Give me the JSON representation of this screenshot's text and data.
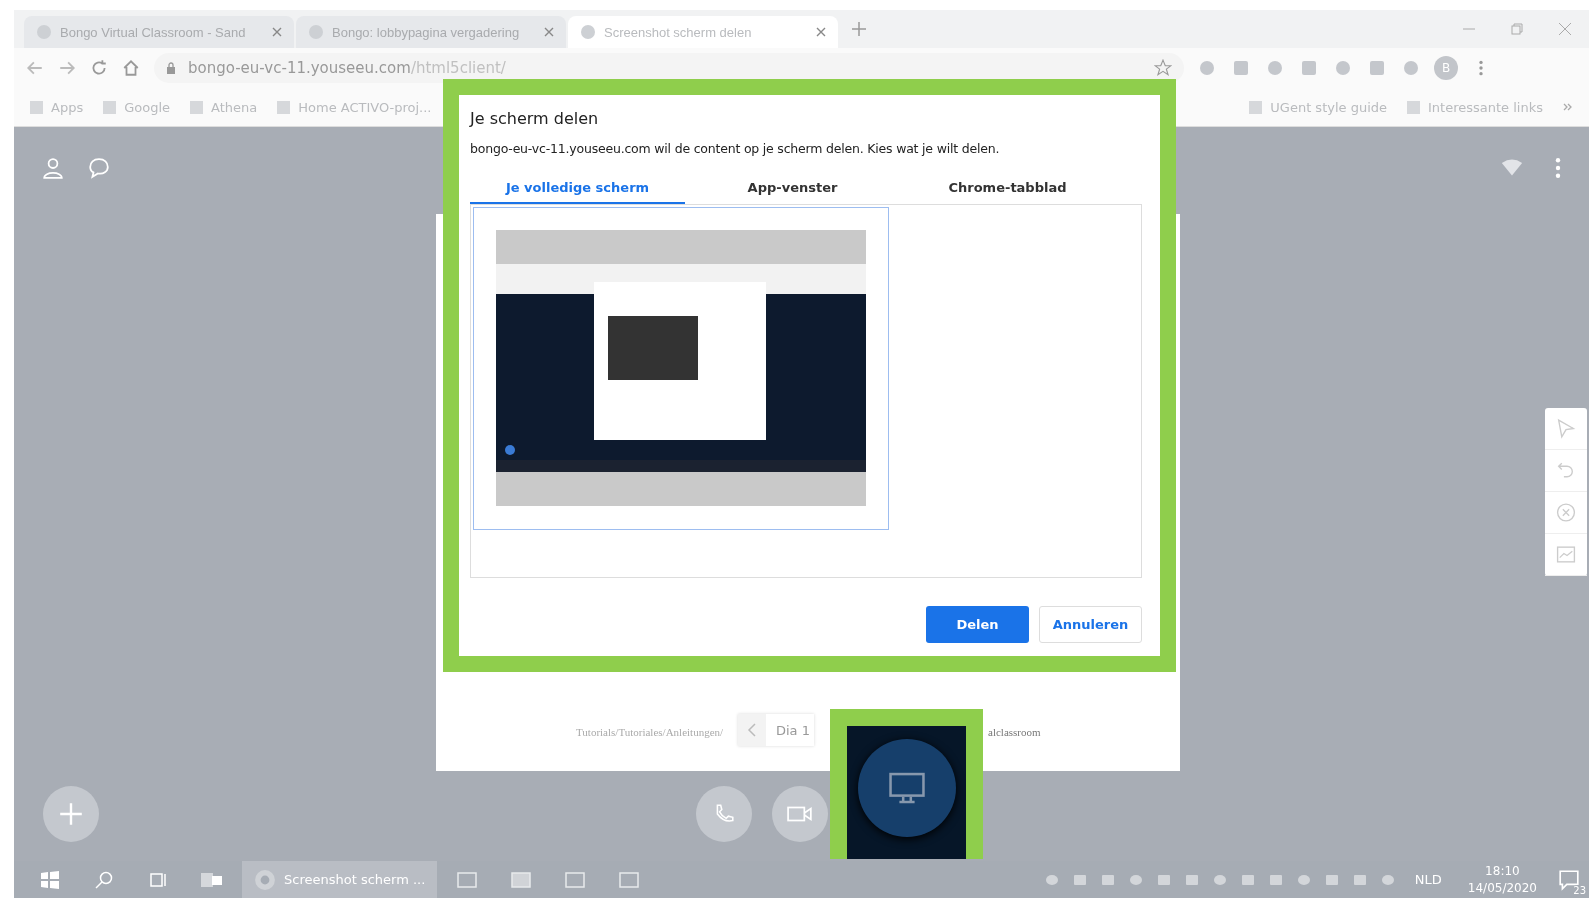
{
  "browser": {
    "tabs": [
      {
        "title": "Bongo Virtual Classroom - Sand",
        "selected": false
      },
      {
        "title": "Bongo: lobbypagina vergadering",
        "selected": false
      },
      {
        "title": "Screenshot scherm delen",
        "selected": true
      }
    ],
    "url": {
      "domain": "bongo-eu-vc-11.youseeu.com",
      "path": "/html5client/"
    },
    "profile": "B",
    "bookmarks_left": [
      "Apps",
      "Google",
      "Athena",
      "Home ACTIVO-proj..."
    ],
    "bookmarks_right": [
      "UGent style guide",
      "Interessante links"
    ]
  },
  "dialog": {
    "title": "Je scherm delen",
    "message": "bongo-eu-vc-11.youseeu.com wil de content op je scherm delen. Kies wat je wilt delen.",
    "tabs": [
      {
        "label": "Je volledige scherm",
        "selected": true
      },
      {
        "label": "App-venster",
        "selected": false
      },
      {
        "label": "Chrome-tabblad",
        "selected": false
      }
    ],
    "buttons": [
      {
        "label": "Delen",
        "kind": "primary"
      },
      {
        "label": "Annuleren",
        "kind": "secondary"
      }
    ]
  },
  "slide": {
    "text_left": "Tutorials/Tutoriales/Anleitungen/",
    "text_right": "alclassroom",
    "page_selector": "Dia 1"
  },
  "taskbar": {
    "active_app": "Screenshot scherm ...",
    "language": "NLD",
    "time": "18:10",
    "date": "14/05/2020",
    "notifications": "23"
  }
}
